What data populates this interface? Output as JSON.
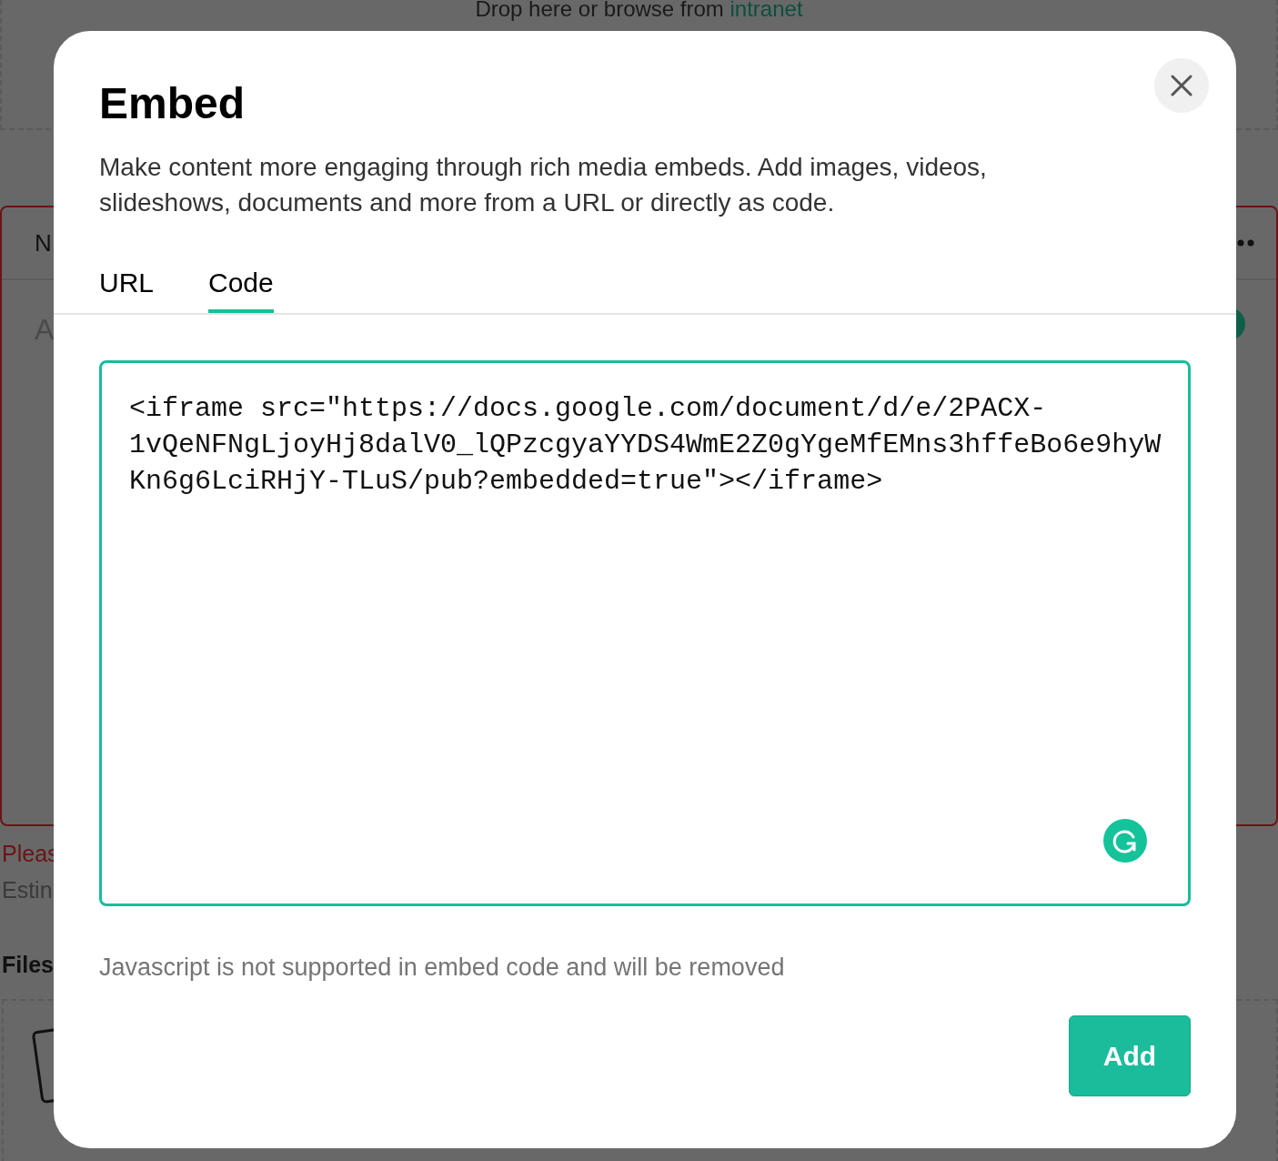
{
  "background": {
    "drop_zone": {
      "text": "Drop here or browse from",
      "link": "intranet"
    },
    "card": {
      "header": "N",
      "placeholder": "A"
    },
    "error": "Pleas",
    "estimate": "Estin",
    "files_heading": "Files"
  },
  "dialog": {
    "title": "Embed",
    "description": "Make content more engaging through rich media embeds. Add images, videos, slideshows, documents and more from a URL or directly as code.",
    "tabs": [
      {
        "label": "URL",
        "selected": false
      },
      {
        "label": "Code",
        "selected": true
      }
    ],
    "code": {
      "value": "<iframe src=\"https://docs.google.com/document/d/e/2PACX-1vQeNFNgLjoyHj8dalV0_lQPzcgyaYYDS4WmE2Z0gYgeMfEMns3hffeBo6e9hyWKn6g6LciRHjY-TLuS/pub?embedded=true\"></iframe>"
    },
    "hint": "Javascript is not supported in embed code and will be removed",
    "add_button": "Add"
  }
}
